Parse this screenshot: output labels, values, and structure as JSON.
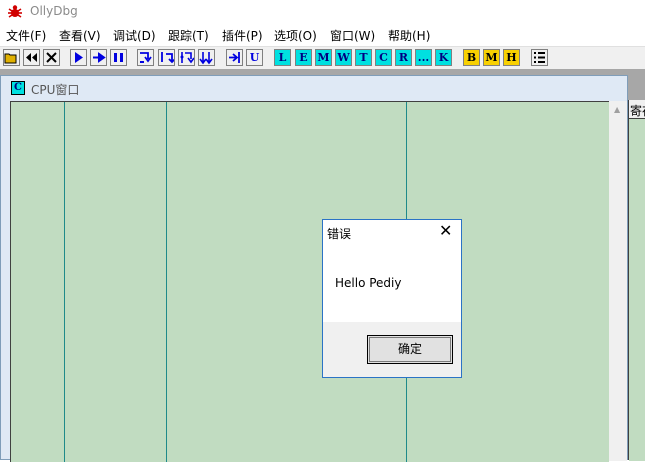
{
  "app": {
    "title": "OllyDbg"
  },
  "menu": [
    "文件(F)",
    "查看(V)",
    "调试(D)",
    "跟踪(T)",
    "插件(P)",
    "选项(O)",
    "窗口(W)",
    "帮助(H)"
  ],
  "toolbar": {
    "letters": [
      "L",
      "E",
      "M",
      "W",
      "T",
      "C",
      "R",
      "...",
      "K"
    ],
    "bookmarks": [
      "B",
      "M",
      "H"
    ],
    "u_label": "U"
  },
  "cpu_window": {
    "icon_letter": "C",
    "title": "CPU窗口"
  },
  "registers_window": {
    "title": "寄存"
  },
  "dialog": {
    "title": "错误",
    "message": "Hello Pediy",
    "ok_label": "确定"
  },
  "colors": {
    "pane_bg": "#c1dcc1",
    "column_line": "#1f8a8a",
    "dialog_border": "#2b73c6"
  }
}
